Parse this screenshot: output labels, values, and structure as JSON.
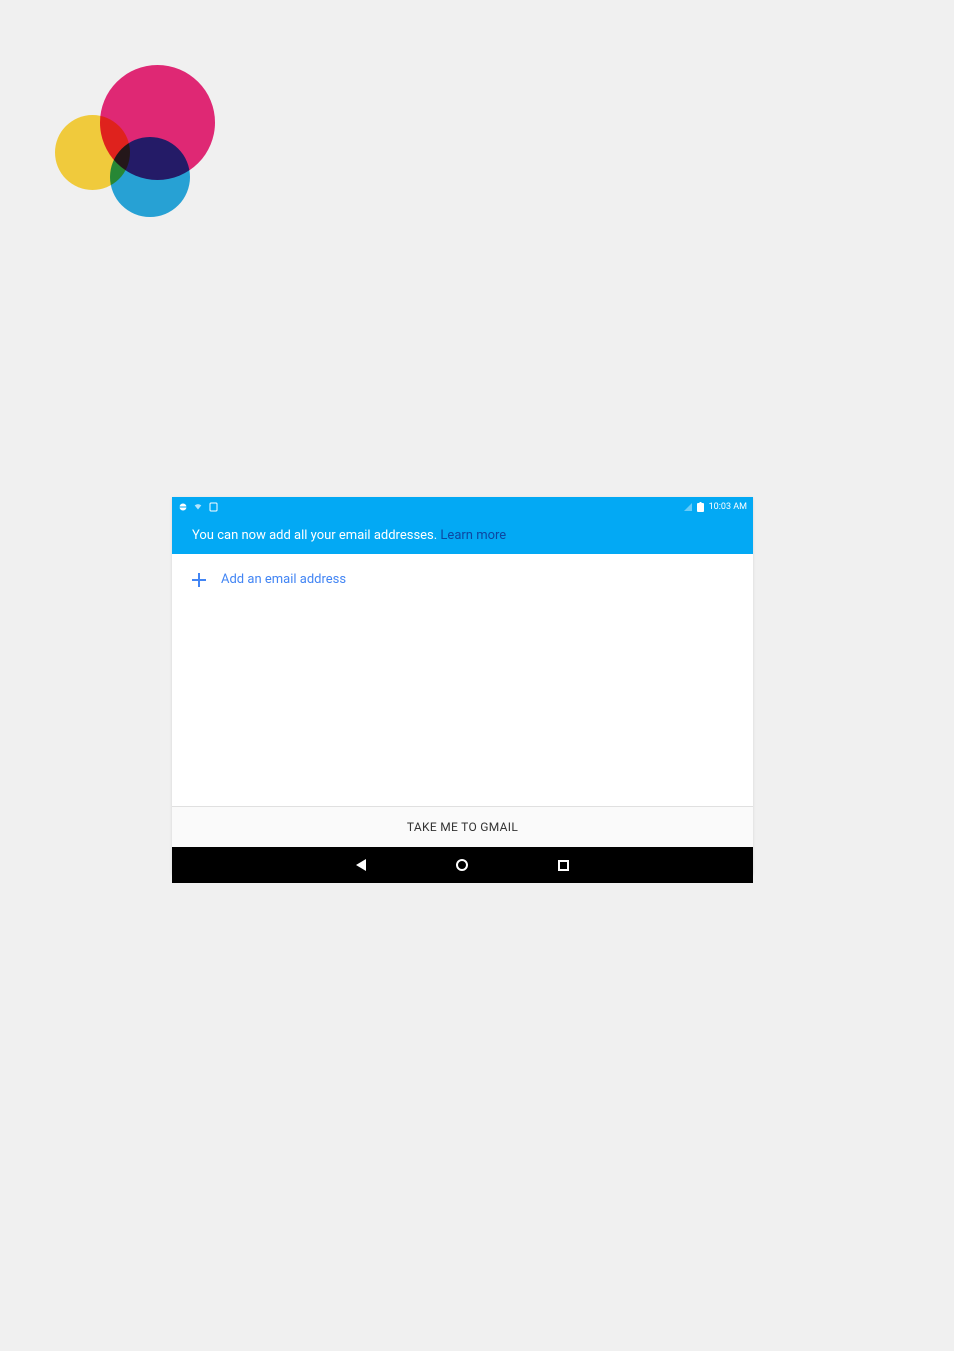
{
  "statusBar": {
    "time": "10:03 AM"
  },
  "header": {
    "message": "You can now add all your email addresses. ",
    "learnMore": "Learn more"
  },
  "addEmail": {
    "label": "Add an email address"
  },
  "footer": {
    "buttonLabel": "TAKE ME TO GMAIL"
  }
}
